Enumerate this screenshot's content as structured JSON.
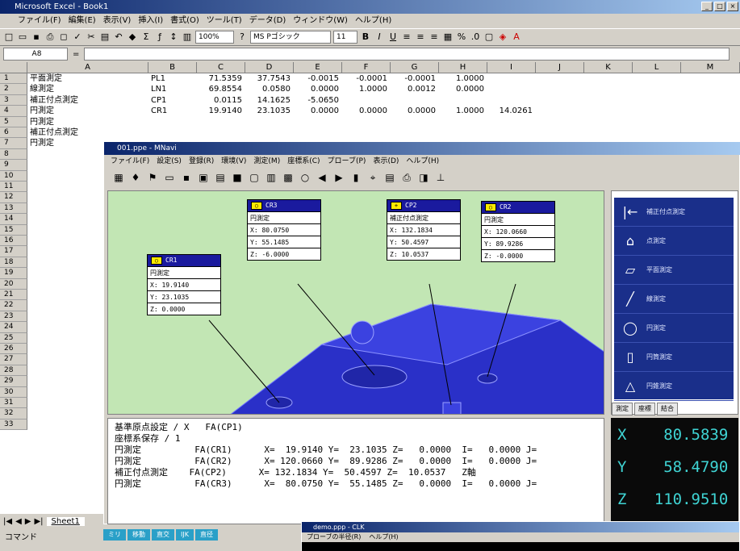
{
  "excel": {
    "title": "Microsoft Excel - Book1",
    "menu": [
      "ファイル(F)",
      "編集(E)",
      "表示(V)",
      "挿入(I)",
      "書式(O)",
      "ツール(T)",
      "データ(D)",
      "ウィンドウ(W)",
      "ヘルプ(H)"
    ],
    "zoom": "100%",
    "font": "MS Pゴシック",
    "font_size": "11",
    "name_box": "A8",
    "columns": [
      "A",
      "B",
      "C",
      "D",
      "E",
      "F",
      "G",
      "H",
      "I",
      "J",
      "K",
      "L",
      "M"
    ],
    "rows": [
      [
        "平面測定",
        "PL1",
        "71.5359",
        "37.7543",
        "-0.0015",
        "-0.0001",
        "-0.0001",
        "1.0000",
        "",
        "",
        "",
        "",
        ""
      ],
      [
        "線測定",
        "LN1",
        "69.8554",
        "0.0580",
        "0.0000",
        "1.0000",
        "0.0012",
        "0.0000",
        "",
        "",
        "",
        "",
        ""
      ],
      [
        "補正付点測定",
        "CP1",
        "0.0115",
        "14.1625",
        "-5.0650",
        "",
        "",
        "",
        "",
        "",
        "",
        "",
        ""
      ],
      [
        "円測定",
        "CR1",
        "19.9140",
        "23.1035",
        "0.0000",
        "0.0000",
        "0.0000",
        "1.0000",
        "14.0261",
        "",
        "",
        "",
        ""
      ],
      [
        "円測定",
        "",
        "",
        "",
        "",
        "",
        "",
        "",
        "",
        "",
        "",
        "",
        ""
      ],
      [
        "補正付点測定",
        "",
        "",
        "",
        "",
        "",
        "",
        "",
        "",
        "",
        "",
        "",
        ""
      ],
      [
        "円測定",
        "",
        "",
        "",
        "",
        "",
        "",
        "",
        "",
        "",
        "",
        "",
        ""
      ]
    ],
    "row_count": 33,
    "sheet_tab": "Sheet1",
    "status": "コマンド"
  },
  "mnavi": {
    "title": "001.ppe - MNavi",
    "menu": [
      "ファイル(F)",
      "設定(S)",
      "登録(R)",
      "環境(V)",
      "測定(M)",
      "座標系(C)",
      "プローブ(P)",
      "表示(D)",
      "ヘルプ(H)"
    ],
    "labels": [
      {
        "tag": "CR3",
        "kind": "円測定",
        "x": "X: 80.0750",
        "y": "Y: 55.1485",
        "z": "Z: -6.0000"
      },
      {
        "tag": "CP2",
        "kind": "補正付点測定",
        "x": "X: 132.1834",
        "y": "Y: 50.4597",
        "z": "Z: 10.0537"
      },
      {
        "tag": "CR2",
        "kind": "円測定",
        "x": "X: 120.0660",
        "y": "Y: 89.9286",
        "z": "Z: -0.0000"
      },
      {
        "tag": "CR1",
        "kind": "円測定",
        "x": "X: 19.9140",
        "y": "Y: 23.1035",
        "z": "Z: 0.0000"
      }
    ],
    "tools": [
      "補正付点測定",
      "点測定",
      "平面測定",
      "線測定",
      "円測定",
      "円筒測定",
      "円錐測定"
    ],
    "tabs": [
      "測定",
      "座標",
      "結合"
    ],
    "log": [
      "基準原点設定 / X   FA(CP1)",
      "座標系保存 / 1",
      "円測定          FA(CR1)      X=  19.9140 Y=  23.1035 Z=   0.0000  I=   0.0000 J=",
      "円測定          FA(CR2)      X= 120.0660 Y=  89.9286 Z=   0.0000  I=   0.0000 J=",
      "補正付点測定    FA(CP2)      X= 132.1834 Y=  50.4597 Z=  10.0537   Z軸",
      "円測定          FA(CR3)      X=  80.0750 Y=  55.1485 Z=   0.0000  I=   0.0000 J="
    ],
    "dro_x": "X    80.5839",
    "dro_y": "Y    58.4790",
    "dro_z": "Z   110.9510"
  },
  "clk": {
    "title": "demo.ppp - CLK",
    "menu": [
      "プローブの半径(R)",
      "ヘルプ(H)"
    ]
  },
  "funckeys": [
    "ミリ",
    "移動",
    "直交",
    "IJK",
    "直径"
  ]
}
